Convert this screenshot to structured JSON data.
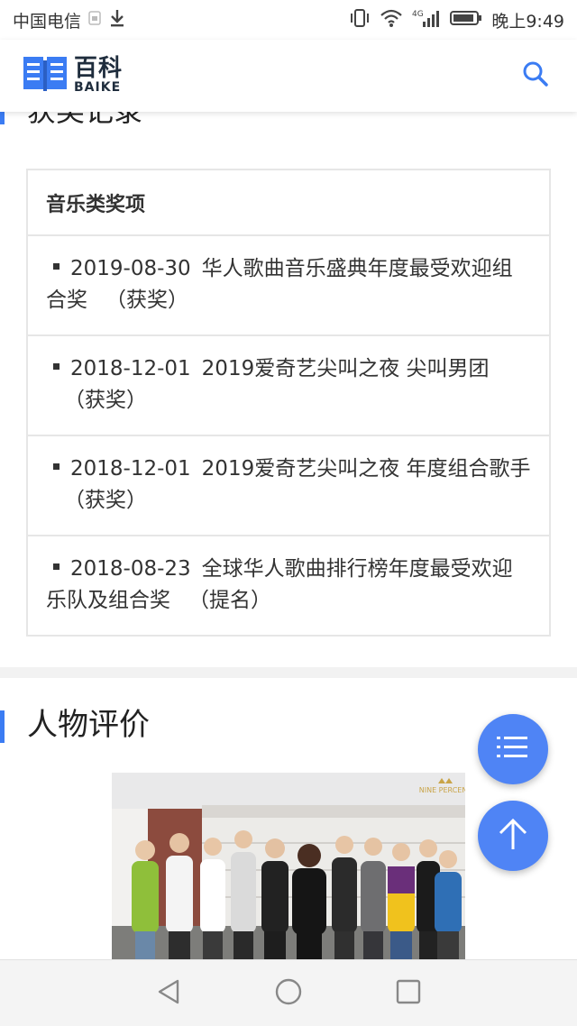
{
  "status_bar": {
    "carrier": "中国电信",
    "time": "晚上9:49",
    "network": "4G"
  },
  "header": {
    "logo_title": "百科",
    "logo_subtitle": "BAIKE",
    "search_icon": "search-icon",
    "accent_color": "#3b7cf3"
  },
  "previous_section": {
    "title": "获奖记录"
  },
  "awards": {
    "category": "音乐类奖项",
    "items": [
      {
        "date": "2019-08-30",
        "name": "华人歌曲音乐盛典年度最受欢迎组合奖",
        "status": "（获奖）"
      },
      {
        "date": "2018-12-01",
        "name": "2019爱奇艺尖叫之夜 尖叫男团",
        "status": "（获奖）"
      },
      {
        "date": "2018-12-01",
        "name": "2019爱奇艺尖叫之夜 年度组合歌手",
        "status": "（获奖）"
      },
      {
        "date": "2018-08-23",
        "name": "全球华人歌曲排行榜年度最受欢迎乐队及组合奖",
        "status": "（提名）"
      }
    ]
  },
  "evaluation_section": {
    "title": "人物评价"
  },
  "photo": {
    "logo_text": "NINE PERCENT"
  },
  "floating": {
    "menu_icon": "list-icon",
    "top_icon": "arrow-up-icon",
    "color": "#4f84f5"
  },
  "navbar": {
    "back_icon": "back-triangle-icon",
    "home_icon": "home-circle-icon",
    "recent_icon": "recent-square-icon"
  }
}
